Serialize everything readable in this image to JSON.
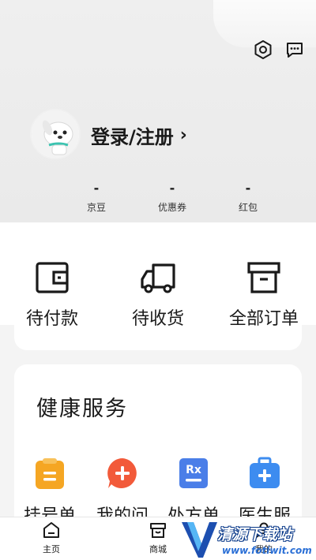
{
  "header": {
    "login_label": "登录/注册",
    "login_arrow": "›"
  },
  "stats": [
    {
      "value": "-",
      "label": "京豆"
    },
    {
      "value": "-",
      "label": "优惠券"
    },
    {
      "value": "-",
      "label": "红包"
    }
  ],
  "orders": [
    {
      "label": "待付款",
      "icon": "wallet-icon"
    },
    {
      "label": "待收货",
      "icon": "truck-icon"
    },
    {
      "label": "全部订单",
      "icon": "box-icon"
    }
  ],
  "health": {
    "title": "健康服务",
    "items": [
      {
        "label": "挂号单",
        "icon": "clipboard-icon",
        "color": "#f5a623"
      },
      {
        "label": "我的问",
        "icon": "consult-icon",
        "color": "#f25a3a"
      },
      {
        "label": "处方单",
        "icon": "prescription-icon",
        "color": "#4a7ee8"
      },
      {
        "label": "医生服",
        "icon": "medkit-icon",
        "color": "#3d8cf0"
      }
    ]
  },
  "tabbar": [
    {
      "label": "主页",
      "icon": "home-icon"
    },
    {
      "label": "商城",
      "icon": "store-icon"
    },
    {
      "label": "我的",
      "icon": "profile-icon"
    }
  ],
  "watermark": {
    "title": "清源下载站",
    "url": "www.fotiwit.com"
  },
  "colors": {
    "header_bg": "#ececec",
    "card_bg": "#ffffff",
    "text": "#1a1a1a"
  }
}
